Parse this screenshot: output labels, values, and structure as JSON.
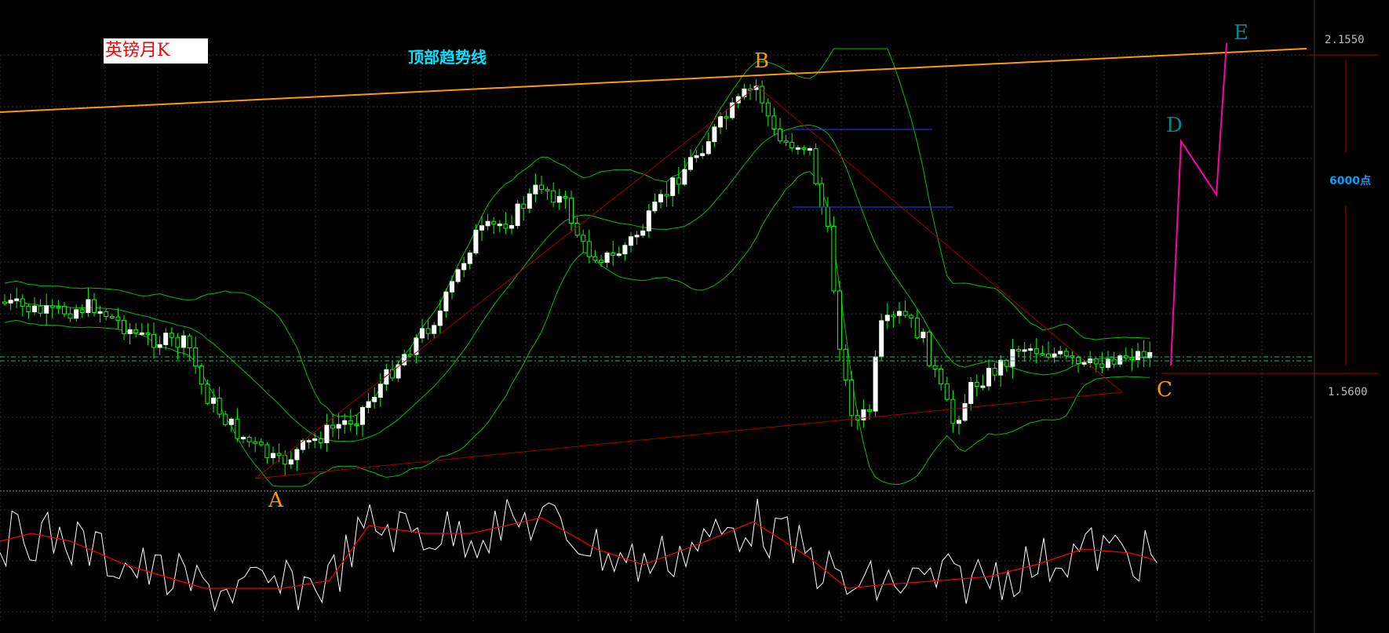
{
  "chart_title": "英镑月K",
  "chart_data": {
    "type": "candlestick",
    "title": "英镑月K",
    "price_labels": {
      "high": "2.1550",
      "low": "1.5600"
    },
    "range_annotation": "6000点",
    "trendline_label": "顶部趋势线",
    "wave_labels": [
      "A",
      "B",
      "C",
      "D",
      "E"
    ],
    "annotation_levels": {
      "top": 2.155,
      "bottom": 1.56
    },
    "colors": {
      "background": "#000000",
      "candle_up": "#ffffff",
      "candle_down": "#00ff00",
      "bands": "#00c000",
      "top_trendline": "#ff9900",
      "wave_lines": "#a00000",
      "projection": "#ff00aa",
      "oscillator": "#ffffff",
      "oscillator_signal": "#ff0000",
      "label_orange": "#ff9900",
      "label_teal": "#008b8b",
      "label_cyan": "#00e5ff",
      "label_blue": "#00a0ff",
      "grid": "#2f2f2f"
    },
    "grid": true
  }
}
